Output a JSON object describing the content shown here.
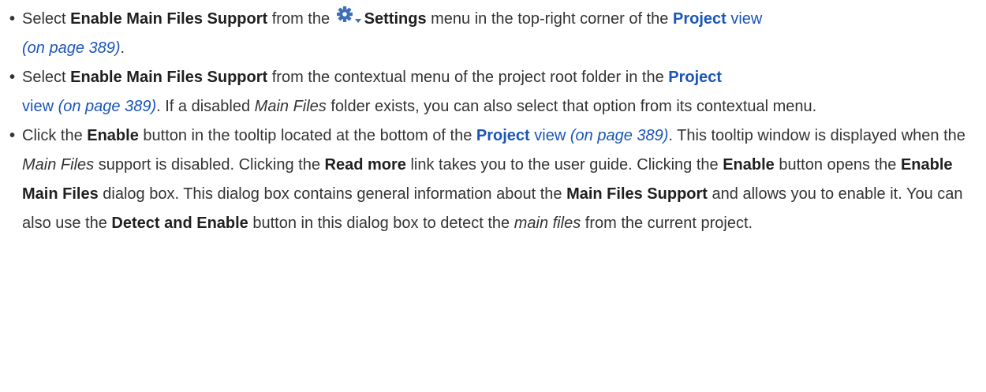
{
  "bullet_symbol": "•",
  "items": [
    {
      "p1": "Select ",
      "b1": "Enable Main Files Support",
      "p2": " from the ",
      "settings_icon": "gear-settings-icon",
      "b2": "Settings",
      "p3": " menu in the top-right corner of the ",
      "link_bold": "Project",
      "link_text": " view",
      "ref": "(on page 389)",
      "end": "."
    },
    {
      "p1": "Select ",
      "b1": "Enable Main Files Support",
      "p2": " from the contextual menu of the project root folder in the ",
      "link_bold": "Project",
      "link_text": "view",
      "ref": "(on page 389)",
      "p3": ". If a disabled ",
      "em1": "Main Files",
      "p4": " folder exists, you can also select that option from its contextual menu."
    },
    {
      "p1": "Click the ",
      "b1": "Enable",
      "p2": " button in the tooltip located at the bottom of the ",
      "link_bold": "Project",
      "link_text": " view",
      "ref": "(on page 389)",
      "p3": ". This tooltip window is displayed when the ",
      "em1": "Main Files",
      "p4": " support is disabled. Clicking the ",
      "b2": "Read more",
      "p5": " link takes you to the user guide. Clicking the ",
      "b3": "Enable",
      "p6": " button opens the ",
      "b4": "Enable Main Files",
      "p7": " dialog box. This dialog box contains general information about the ",
      "b5": "Main Files Support",
      "p8": " and allows you to enable it. You can also use the ",
      "b6": "Detect and Enable",
      "p9": " button in this dialog box to detect the ",
      "em2": "main files",
      "p10": " from the current project."
    }
  ]
}
